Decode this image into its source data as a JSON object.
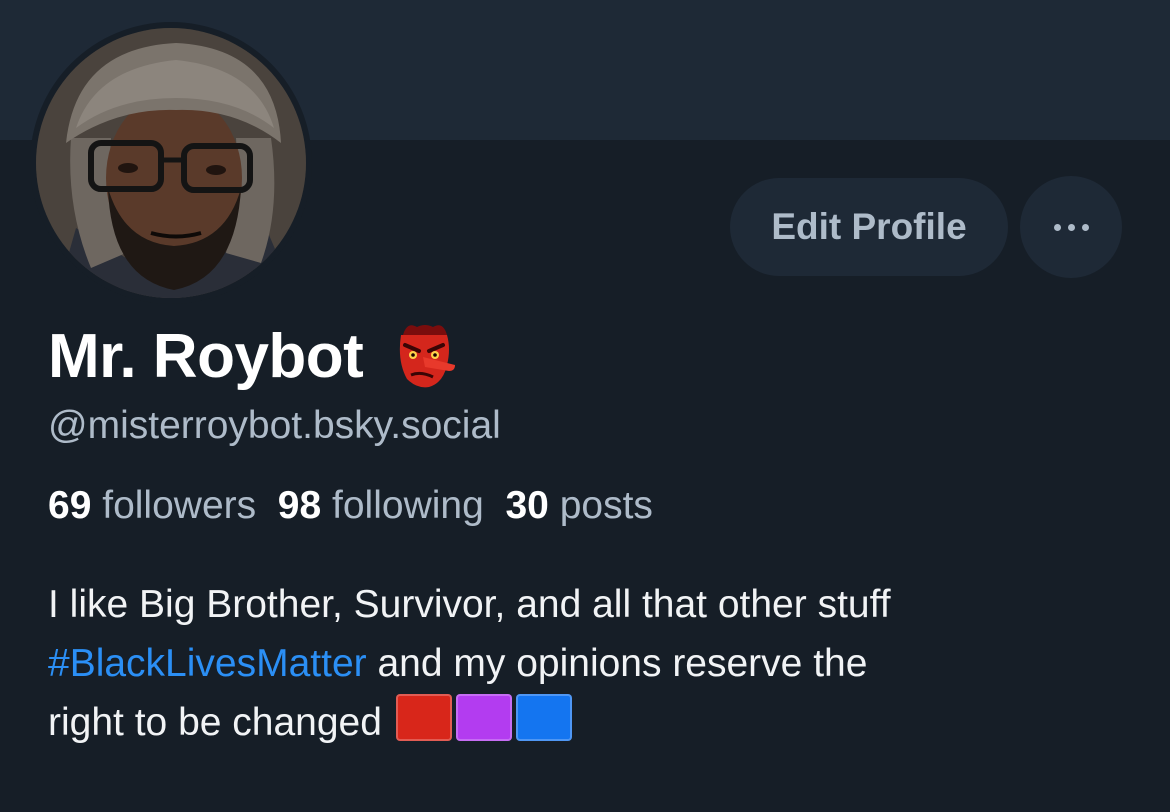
{
  "profile": {
    "display_name": "Mr. Roybot",
    "name_emoji": "tengu-mask-icon",
    "handle": "@misterroybot.bsky.social",
    "edit_button_label": "Edit Profile",
    "more_button": "more-options-icon"
  },
  "stats": {
    "followers_count": "69",
    "followers_label": "followers",
    "following_count": "98",
    "following_label": "following",
    "posts_count": "30",
    "posts_label": "posts"
  },
  "bio": {
    "line1": "I like Big Brother, Survivor, and all that other stuff",
    "hashtag": "#BlackLivesMatter",
    "line2_rest": " and my opinions reserve the",
    "line3": "right to be changed",
    "square_emojis": [
      "red-square-icon",
      "purple-square-icon",
      "blue-square-icon"
    ]
  },
  "colors": {
    "background": "#161e27",
    "banner": "#1e2936",
    "button_bg": "#1e2936",
    "muted_text": "#aebbc9",
    "hashtag": "#2b8ff5",
    "square_red": "#d8261a",
    "square_purple": "#b33cf0",
    "square_blue": "#1475f0"
  }
}
